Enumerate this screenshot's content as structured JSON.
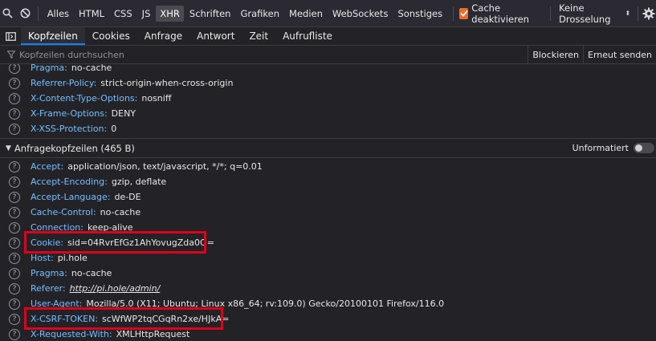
{
  "toolbar": {
    "filters": [
      {
        "label": "Alles",
        "active": false
      },
      {
        "label": "HTML",
        "active": false
      },
      {
        "label": "CSS",
        "active": false
      },
      {
        "label": "JS",
        "active": false
      },
      {
        "label": "XHR",
        "active": true
      },
      {
        "label": "Schriften",
        "active": false
      },
      {
        "label": "Grafiken",
        "active": false
      },
      {
        "label": "Medien",
        "active": false
      },
      {
        "label": "WebSockets",
        "active": false
      },
      {
        "label": "Sonstiges",
        "active": false
      }
    ],
    "cache_label": "Cache deaktivieren",
    "cache_checked": true,
    "throttle_label": "Keine Drosselung",
    "icons": [
      "search-icon",
      "block-icon",
      "gear-icon"
    ]
  },
  "tabs": {
    "items": [
      "Kopfzeilen",
      "Cookies",
      "Anfrage",
      "Antwort",
      "Zeit",
      "Aufrufliste"
    ],
    "active": "Kopfzeilen"
  },
  "search": {
    "placeholder": "Kopfzeilen durchsuchen",
    "block_label": "Blockieren",
    "resend_label": "Erneut senden"
  },
  "response_headers_tail": [
    {
      "name": "Pragma:",
      "value": "no-cache"
    },
    {
      "name": "Referrer-Policy:",
      "value": "strict-origin-when-cross-origin"
    },
    {
      "name": "X-Content-Type-Options:",
      "value": "nosniff"
    },
    {
      "name": "X-Frame-Options:",
      "value": "DENY"
    },
    {
      "name": "X-XSS-Protection:",
      "value": "0"
    }
  ],
  "request_section": {
    "title": "Anfragekopfzeilen (465 B)",
    "raw_label": "Unformatiert"
  },
  "request_headers": [
    {
      "name": "Accept:",
      "value": "application/json, text/javascript, */*; q=0.01"
    },
    {
      "name": "Accept-Encoding:",
      "value": "gzip, deflate"
    },
    {
      "name": "Accept-Language:",
      "value": "de-DE"
    },
    {
      "name": "Cache-Control:",
      "value": "no-cache"
    },
    {
      "name": "Connection:",
      "value": "keep-alive"
    },
    {
      "name": "Cookie:",
      "value": "sid=04RvrEfGz1AhYovugZda0Q="
    },
    {
      "name": "Host:",
      "value": "pi.hole"
    },
    {
      "name": "Pragma:",
      "value": "no-cache"
    },
    {
      "name": "Referer:",
      "value": "http://pi.hole/admin/",
      "link": true
    },
    {
      "name": "User-Agent:",
      "value": "Mozilla/5.0 (X11; Ubuntu; Linux x86_64; rv:109.0) Gecko/20100101 Firefox/116.0"
    },
    {
      "name": "X-CSRF-TOKEN:",
      "value": "scWfWP2tqCGqRn2xe/HJkA="
    },
    {
      "name": "X-Requested-With:",
      "value": "XMLHttpRequest"
    }
  ],
  "colors": {
    "accent": "#0a84ff",
    "header_name": "#75bfff",
    "highlight": "#e0001b",
    "checkbox": "#f06a24"
  }
}
